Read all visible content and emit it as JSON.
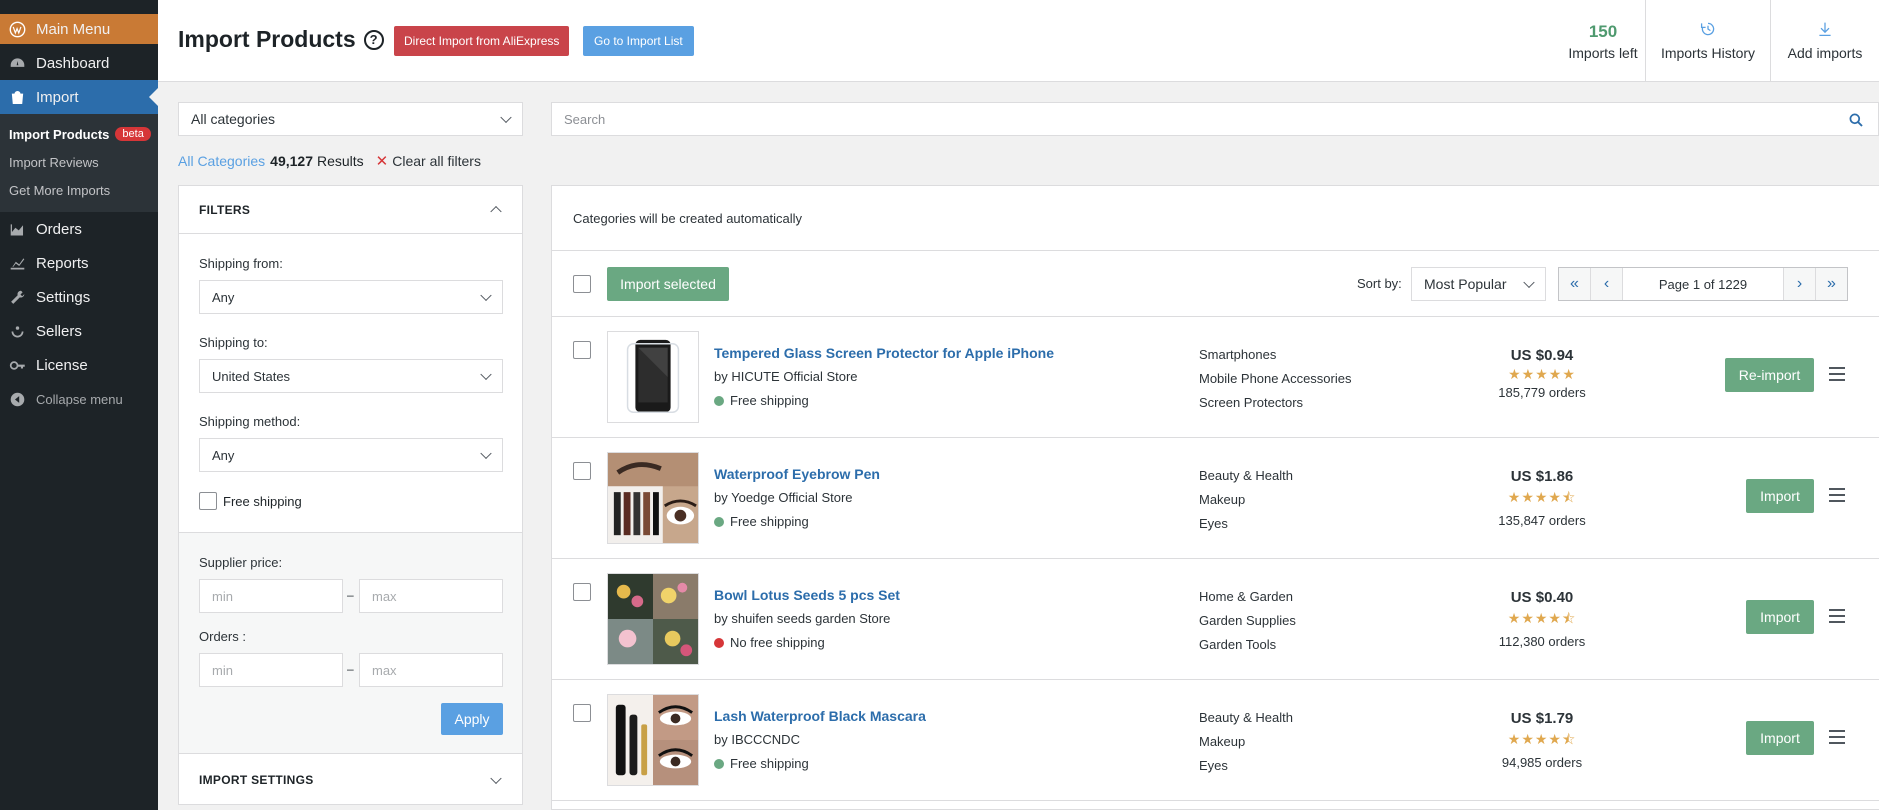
{
  "sidebar": {
    "main_menu": "Main Menu",
    "dashboard": "Dashboard",
    "import": "Import",
    "submenu": {
      "import_products": "Import Products",
      "beta": "beta",
      "import_reviews": "Import Reviews",
      "get_more_imports": "Get More Imports"
    },
    "orders": "Orders",
    "reports": "Reports",
    "settings": "Settings",
    "sellers": "Sellers",
    "license": "License",
    "collapse": "Collapse menu"
  },
  "header": {
    "title": "Import Products",
    "help": "?",
    "direct_import": "Direct Import from AliExpress",
    "go_to_list": "Go to Import List",
    "imports_left_count": "150",
    "imports_left_label": "Imports left",
    "history_label": "Imports History",
    "add_label": "Add imports"
  },
  "filters": {
    "category_value": "All categories",
    "results": {
      "all_link": "All Categories",
      "count": "49,127",
      "label": "Results",
      "clear": "Clear all filters"
    },
    "heading": "FILTERS",
    "shipping_from_label": "Shipping from:",
    "shipping_from_value": "Any",
    "shipping_to_label": "Shipping to:",
    "shipping_to_value": "United States",
    "shipping_method_label": "Shipping method:",
    "shipping_method_value": "Any",
    "free_shipping_label": "Free shipping",
    "supplier_price_label": "Supplier price:",
    "orders_label": "Orders :",
    "min_placeholder": "min",
    "max_placeholder": "max",
    "dash": "–",
    "apply": "Apply",
    "import_settings": "IMPORT SETTINGS"
  },
  "search": {
    "placeholder": "Search"
  },
  "list": {
    "notice": "Categories will be created automatically",
    "import_selected": "Import selected",
    "sort_label": "Sort by:",
    "sort_value": "Most Popular",
    "page_info": "Page 1 of 1229",
    "products": [
      {
        "title": "Tempered Glass Screen Protector for Apple iPhone",
        "store": "by HICUTE Official Store",
        "shipping": "Free shipping",
        "free": true,
        "cats": [
          "Smartphones",
          "Mobile Phone Accessories",
          "Screen Protectors"
        ],
        "price": "US $0.94",
        "stars": "★★★★★",
        "orders": "185,779 orders",
        "action": "Re-import"
      },
      {
        "title": "Waterproof Eyebrow Pen",
        "store": "by Yoedge Official Store",
        "shipping": "Free shipping",
        "free": true,
        "cats": [
          "Beauty & Health",
          "Makeup",
          "Eyes"
        ],
        "price": "US $1.86",
        "stars": "★★★★⯪",
        "orders": "135,847 orders",
        "action": "Import"
      },
      {
        "title": "Bowl Lotus Seeds 5 pcs Set",
        "store": "by shuifen seeds garden Store",
        "shipping": "No free shipping",
        "free": false,
        "cats": [
          "Home & Garden",
          "Garden Supplies",
          "Garden Tools"
        ],
        "price": "US $0.40",
        "stars": "★★★★⯪",
        "orders": "112,380 orders",
        "action": "Import"
      },
      {
        "title": "Lash Waterproof Black Mascara",
        "store": "by IBCCCNDC",
        "shipping": "Free shipping",
        "free": true,
        "cats": [
          "Beauty & Health",
          "Makeup",
          "Eyes"
        ],
        "price": "US $1.79",
        "stars": "★★★★⯪",
        "orders": "94,985 orders",
        "action": "Import"
      }
    ]
  },
  "colors": {
    "accent_blue": "#5aa0e2",
    "danger_red": "#c9444a",
    "success_green": "#6aa882",
    "sidebar_bg": "#1d2327",
    "main_menu_orange": "#c97a35"
  }
}
